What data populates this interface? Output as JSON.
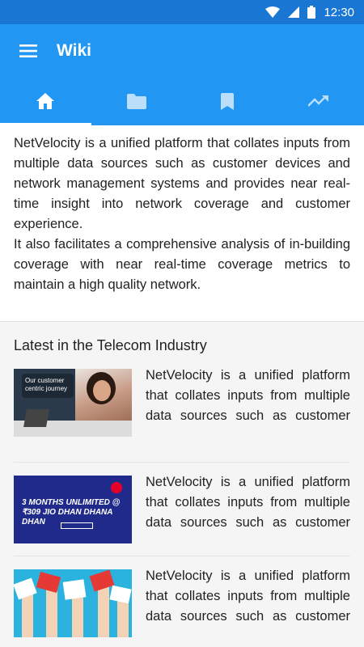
{
  "status_bar": {
    "time": "12:30",
    "icons": [
      "wifi-icon",
      "cell-signal-icon",
      "battery-icon"
    ]
  },
  "app_bar": {
    "title": "Wiki",
    "menu_icon": "menu-icon"
  },
  "tabs": [
    {
      "icon": "home-icon",
      "active": true
    },
    {
      "icon": "folder-icon",
      "active": false
    },
    {
      "icon": "bookmark-icon",
      "active": false
    },
    {
      "icon": "trending-up-icon",
      "active": false
    }
  ],
  "intro": {
    "paragraph1": "NetVelocity is a unified platform that collates inputs from multiple data sources such as customer devices and network management systems and provides near real-time insight into network coverage and customer experience.",
    "paragraph2": "It also facilitates a comprehensive analysis of in-building coverage with near real-time coverage metrics to maintain a high quality network."
  },
  "latest": {
    "title": "Latest in the Telecom Industry",
    "items": [
      {
        "text": "NetVelocity is a unified platform that collates inputs from multiple data sources such as customer devices and network management systems",
        "thumb_caption": "Our customer centric journey"
      },
      {
        "text": "NetVelocity is a unified platform that collates inputs from multiple data sources such as customer devices and network management systems",
        "thumb_caption": "3 MONTHS UNLIMITED @ ₹309 JIO DHAN DHANA DHAN"
      },
      {
        "text": "NetVelocity is a unified platform that collates inputs from multiple data sources such as customer devices and network management systems",
        "thumb_caption": ""
      }
    ]
  },
  "colors": {
    "status_bar": "#1976d2",
    "primary": "#2196f3",
    "background": "#f5f5f5",
    "text": "#222222"
  }
}
